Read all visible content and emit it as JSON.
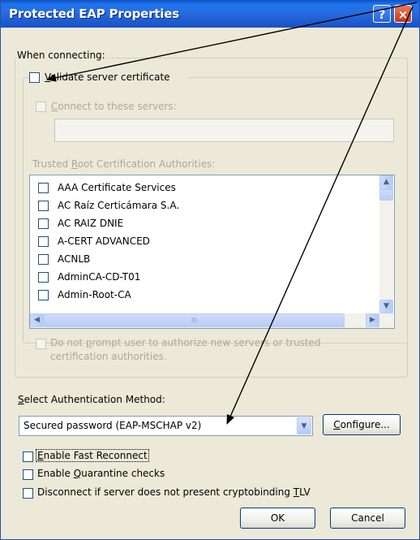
{
  "window": {
    "title": "Protected EAP Properties",
    "help_glyph": "?",
    "close_glyph": "×"
  },
  "connecting": {
    "section_label": "When connecting:",
    "validate_cert": {
      "key": "V",
      "rest": "alidate server certificate",
      "checked": false
    },
    "connect_servers": {
      "pre": "",
      "key": "C",
      "rest": "onnect to these servers:",
      "checked": false,
      "enabled": false
    },
    "servers_value": "",
    "trusted_label": {
      "pre": "Trusted ",
      "key": "R",
      "rest": "oot Certification Authorities:"
    },
    "ca_list": [
      {
        "label": "AAA Certificate Services",
        "checked": false
      },
      {
        "label": "AC Raíz Certicámara S.A.",
        "checked": false
      },
      {
        "label": "AC RAIZ DNIE",
        "checked": false
      },
      {
        "label": "A-CERT ADVANCED",
        "checked": false
      },
      {
        "label": "ACNLB",
        "checked": false
      },
      {
        "label": "AdminCA-CD-T01",
        "checked": false
      },
      {
        "label": "Admin-Root-CA",
        "checked": false
      }
    ],
    "hscroll_grip": "III",
    "no_prompt": {
      "line1_pre": "Do not ",
      "line1_key": "p",
      "line1_rest": "rompt user to authorize new servers or trusted",
      "line2": "certification authorities.",
      "checked": false,
      "enabled": false
    }
  },
  "auth": {
    "label_key": "S",
    "label_rest": "elect Authentication Method:",
    "selected": "Secured password (EAP-MSCHAP v2)",
    "configure_key": "C",
    "configure_rest": "onfigure..."
  },
  "options": {
    "fast_reconnect": {
      "key": "E",
      "rest": "nable Fast Reconnect",
      "checked": false
    },
    "quarantine": {
      "pre": "Enable ",
      "key": "Q",
      "rest": "uarantine checks",
      "checked": false
    },
    "cryptobinding": {
      "pre": "Disconnect if server does not present cryptobinding ",
      "key": "T",
      "rest": "LV",
      "checked": false
    }
  },
  "buttons": {
    "ok": "OK",
    "cancel": "Cancel"
  },
  "colors": {
    "title_bar": "#1f5fd4",
    "dialog_bg": "#ece9d8",
    "disabled_text": "#aca899",
    "annotation_arrow": "#000000"
  }
}
